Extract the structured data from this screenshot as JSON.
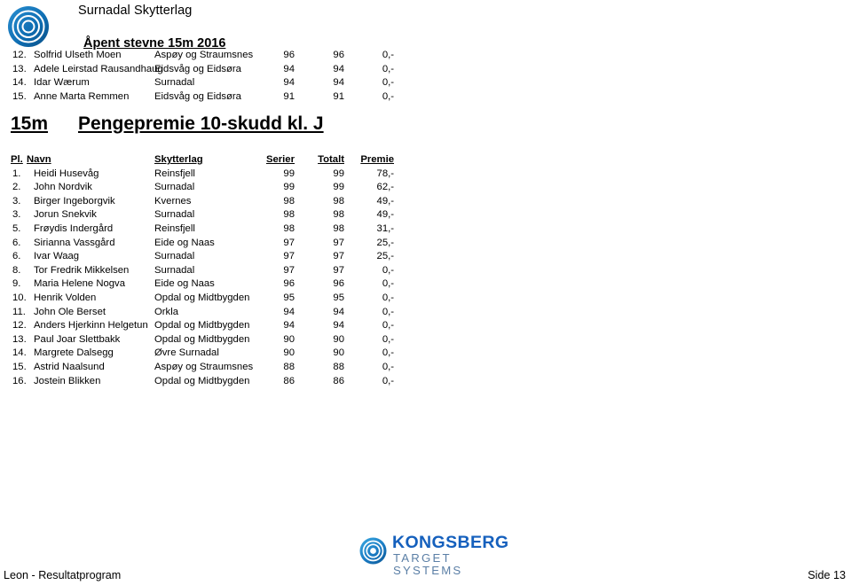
{
  "header": {
    "club_name": "Surnadal Skytterlag",
    "event_title": "Åpent stevne 15m 2016",
    "logo_icon": "target-rings-icon"
  },
  "continued_rows": [
    {
      "pl": "12.",
      "name": "Solfrid Ulseth Moen",
      "team": "Aspøy og Straumsnes",
      "serier": "96",
      "totalt": "96",
      "premie": "0,-"
    },
    {
      "pl": "13.",
      "name": "Adele Leirstad Rausandhaug",
      "team": "Eidsvåg og Eidsøra",
      "serier": "94",
      "totalt": "94",
      "premie": "0,-"
    },
    {
      "pl": "14.",
      "name": "Idar Wærum",
      "team": "Surnadal",
      "serier": "94",
      "totalt": "94",
      "premie": "0,-"
    },
    {
      "pl": "15.",
      "name": "Anne Marta Remmen",
      "team": "Eidsvåg og Eidsøra",
      "serier": "91",
      "totalt": "91",
      "premie": "0,-"
    }
  ],
  "section": {
    "distance": "15m",
    "name": "Pengepremie 10-skudd kl. J"
  },
  "table": {
    "columns": {
      "pl": "Pl.",
      "navn": "Navn",
      "skytterlag": "Skytterlag",
      "serier": "Serier",
      "totalt": "Totalt",
      "premie": "Premie"
    },
    "rows": [
      {
        "pl": "1.",
        "name": "Heidi Husevåg",
        "team": "Reinsfjell",
        "serier": "99",
        "totalt": "99",
        "premie": "78,-"
      },
      {
        "pl": "2.",
        "name": "John Nordvik",
        "team": "Surnadal",
        "serier": "99",
        "totalt": "99",
        "premie": "62,-"
      },
      {
        "pl": "3.",
        "name": "Birger Ingeborgvik",
        "team": "Kvernes",
        "serier": "98",
        "totalt": "98",
        "premie": "49,-"
      },
      {
        "pl": "3.",
        "name": "Jorun Snekvik",
        "team": "Surnadal",
        "serier": "98",
        "totalt": "98",
        "premie": "49,-"
      },
      {
        "pl": "5.",
        "name": "Frøydis Indergård",
        "team": "Reinsfjell",
        "serier": "98",
        "totalt": "98",
        "premie": "31,-"
      },
      {
        "pl": "6.",
        "name": "Sirianna Vassgård",
        "team": "Eide og Naas",
        "serier": "97",
        "totalt": "97",
        "premie": "25,-"
      },
      {
        "pl": "6.",
        "name": "Ivar Waag",
        "team": "Surnadal",
        "serier": "97",
        "totalt": "97",
        "premie": "25,-"
      },
      {
        "pl": "8.",
        "name": "Tor Fredrik Mikkelsen",
        "team": "Surnadal",
        "serier": "97",
        "totalt": "97",
        "premie": "0,-"
      },
      {
        "pl": "9.",
        "name": "Maria Helene Nogva",
        "team": "Eide og Naas",
        "serier": "96",
        "totalt": "96",
        "premie": "0,-"
      },
      {
        "pl": "10.",
        "name": "Henrik Volden",
        "team": "Opdal og Midtbygden",
        "serier": "95",
        "totalt": "95",
        "premie": "0,-"
      },
      {
        "pl": "11.",
        "name": "John Ole Berset",
        "team": "Orkla",
        "serier": "94",
        "totalt": "94",
        "premie": "0,-"
      },
      {
        "pl": "12.",
        "name": "Anders Hjerkinn Helgetun",
        "team": "Opdal og Midtbygden",
        "serier": "94",
        "totalt": "94",
        "premie": "0,-"
      },
      {
        "pl": "13.",
        "name": "Paul Joar Slettbakk",
        "team": "Opdal og Midtbygden",
        "serier": "90",
        "totalt": "90",
        "premie": "0,-"
      },
      {
        "pl": "14.",
        "name": "Margrete Dalsegg",
        "team": "Øvre Surnadal",
        "serier": "90",
        "totalt": "90",
        "premie": "0,-"
      },
      {
        "pl": "15.",
        "name": "Astrid Naalsund",
        "team": "Aspøy og Straumsnes",
        "serier": "88",
        "totalt": "88",
        "premie": "0,-"
      },
      {
        "pl": "16.",
        "name": "Jostein Blikken",
        "team": "Opdal og Midtbygden",
        "serier": "86",
        "totalt": "86",
        "premie": "0,-"
      }
    ]
  },
  "footer": {
    "left": "Leon - Resultatprogram",
    "right": "Side 13",
    "logo": {
      "word": "KONGSBERG",
      "sub": "TARGET SYSTEMS",
      "icon": "target-rings-icon",
      "word_color": "#1560bd",
      "sub_color": "#5b7fa6"
    }
  }
}
